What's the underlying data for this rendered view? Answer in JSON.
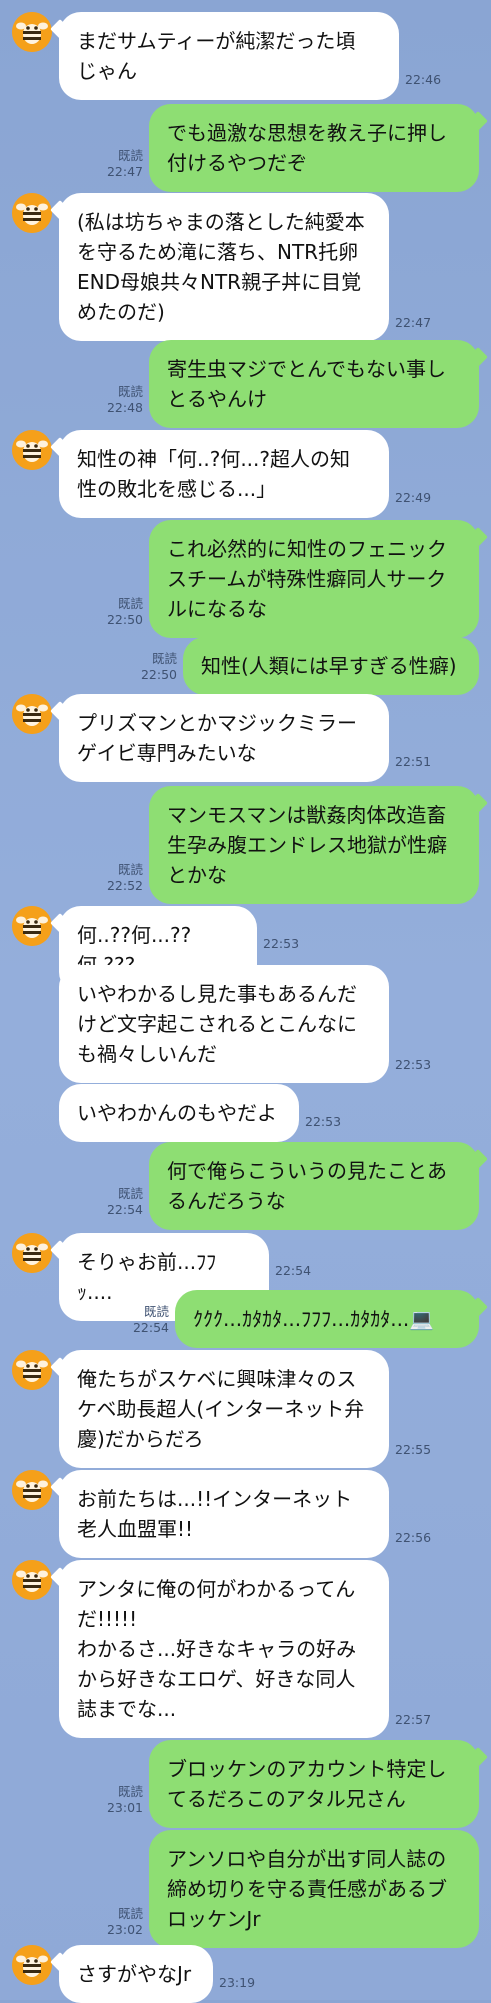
{
  "read_label": "既読",
  "messages": [
    {
      "dir": "in",
      "avatar": true,
      "text": "まだサムティーが純潔だった頃\nじゃん",
      "time": "22:46"
    },
    {
      "dir": "out",
      "text": "でも過激な思想を教え子に押し\n付けるやつだぞ",
      "time": "22:47"
    },
    {
      "dir": "in",
      "avatar": true,
      "text": "(私は坊ちゃまの落とした純愛本\nを守るため滝に落ち、NTR托卵\nEND母娘共々NTR親子丼に目覚\nめたのだ)",
      "time": "22:47"
    },
    {
      "dir": "out",
      "text": "寄生虫マジでとんでもない事し\nとるやんけ",
      "time": "22:48"
    },
    {
      "dir": "in",
      "avatar": true,
      "text": "知性の神「何..?何...?超人の知\n性の敗北を感じる...」",
      "time": "22:49"
    },
    {
      "dir": "out",
      "text": "これ必然的に知性のフェニック\nスチームが特殊性癖同人サーク\nルになるな",
      "time": "22:50"
    },
    {
      "dir": "out",
      "text": "知性(人類には早すぎる性癖)",
      "time": "22:50"
    },
    {
      "dir": "in",
      "avatar": true,
      "text": "プリズマンとかマジックミラー\nゲイビ専門みたいな",
      "time": "22:51"
    },
    {
      "dir": "out",
      "text": "マンモスマンは獣姦肉体改造畜\n生孕み腹エンドレス地獄が性癖\nとかな",
      "time": "22:52"
    },
    {
      "dir": "in",
      "avatar": true,
      "text": "何..??何...??何.???",
      "time": "22:53"
    },
    {
      "dir": "in",
      "text": "いやわかるし見た事もあるんだ\nけど文字起こされるとこんなに\nも禍々しいんだ",
      "time": "22:53"
    },
    {
      "dir": "in",
      "text": "いやわかんのもやだよ",
      "time": "22:53"
    },
    {
      "dir": "out",
      "text": "何で俺らこういうの見たことあ\nるんだろうな",
      "time": "22:54"
    },
    {
      "dir": "in",
      "avatar": true,
      "text": "そりゃお前...ﾌﾌｯ....",
      "time": "22:54"
    },
    {
      "dir": "out",
      "text": "ｸｸｸ...ｶﾀｶﾀ...ﾌﾌﾌ...ｶﾀｶﾀ...💻",
      "time": "22:54"
    },
    {
      "dir": "in",
      "avatar": true,
      "text": "俺たちがスケベに興味津々のス\nケベ助長超人(インターネット弁\n慶)だからだろ",
      "time": "22:55"
    },
    {
      "dir": "in",
      "avatar": true,
      "text": "お前たちは...!!インターネット\n老人血盟軍!!",
      "time": "22:56"
    },
    {
      "dir": "in",
      "avatar": true,
      "text": "アンタに俺の何がわかるってん\nだ!!!!!\nわかるさ...好きなキャラの好み\nから好きなエロゲ、好きな同人\n誌までな...",
      "time": "22:57"
    },
    {
      "dir": "out",
      "text": "ブロッケンのアカウント特定し\nてるだろこのアタル兄さん",
      "time": "23:01"
    },
    {
      "dir": "out",
      "text": "アンソロや自分が出す同人誌の\n締め切りを守る責任感があるブ\nロッケンJr",
      "time": "23:02"
    },
    {
      "dir": "in",
      "avatar": true,
      "text": "さすがやなJr",
      "time": "23:19"
    }
  ]
}
